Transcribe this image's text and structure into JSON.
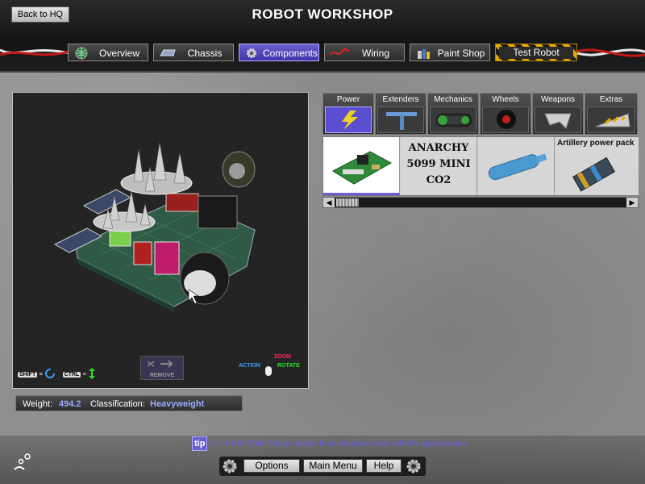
{
  "header": {
    "back_label": "Back to HQ",
    "title": "ROBOT WORKSHOP"
  },
  "nav_tabs": [
    {
      "label": "Overview",
      "icon": "globe-icon",
      "active": false
    },
    {
      "label": "Chassis",
      "icon": "chassis-icon",
      "active": false
    },
    {
      "label": "Components",
      "icon": "gear-icon",
      "active": true
    },
    {
      "label": "Wiring",
      "icon": "wire-icon",
      "active": false
    },
    {
      "label": "Paint Shop",
      "icon": "paint-can-icon",
      "active": false
    },
    {
      "label": "Test Robot",
      "icon": "",
      "active": false
    }
  ],
  "viewport": {
    "shift_key": "SHIFT",
    "ctrl_key": "CTRL",
    "remove_label": "REMOVE",
    "legend": {
      "zoom": "ZOOM",
      "action": "ACTION",
      "rotate": "ROTATE"
    }
  },
  "stats": {
    "weight_label": "Weight:",
    "weight_value": "494.2",
    "class_label": "Classification:",
    "class_value": "Heavyweight"
  },
  "categories": [
    {
      "label": "Power",
      "icon": "lightning-icon",
      "active": true
    },
    {
      "label": "Extenders",
      "icon": "t-bar-icon",
      "active": false
    },
    {
      "label": "Mechanics",
      "icon": "chain-drive-icon",
      "active": false
    },
    {
      "label": "Wheels",
      "icon": "wheel-icon",
      "active": false
    },
    {
      "label": "Weapons",
      "icon": "blade-icon",
      "active": false
    },
    {
      "label": "Extras",
      "icon": "wedge-icon",
      "active": false
    }
  ],
  "items": [
    {
      "label": "",
      "icon": "circuit-board-icon",
      "selected": true
    },
    {
      "label": "ANARCHY 5099 MINI CO2",
      "icon": "co2-text-icon",
      "selected": false
    },
    {
      "label": "",
      "icon": "gas-cylinder-icon",
      "selected": false
    },
    {
      "label": "Artillery power pack",
      "icon": "power-pack-icon",
      "selected": false
    }
  ],
  "tip": {
    "tag": "tip",
    "text": "Click the Paint Shop button to customize your robot's appearance."
  },
  "bottom_buttons": {
    "options": "Options",
    "main_menu": "Main Menu",
    "help": "Help"
  },
  "colors": {
    "accent": "#6a5fd0",
    "value_text": "#9fa8ff",
    "zoom": "#ff2a5a",
    "rotate": "#28e028",
    "action": "#3aa0ff"
  }
}
